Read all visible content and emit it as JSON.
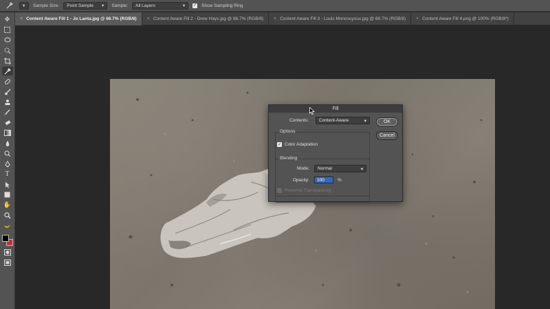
{
  "options_bar": {
    "tool_icon": "eyedropper-icon",
    "sample_size_label": "Sample Size:",
    "sample_size_value": "Point Sample",
    "sample_label": "Sample:",
    "sample_value": "All Layers",
    "show_sampling_ring_label": "Show Sampling Ring"
  },
  "tabs": [
    {
      "label": "Content Aware Fill 1 - Jo Lanta.jpg @ 66.7% (RGB/8)",
      "active": true
    },
    {
      "label": "Content Aware Fill 2 - Drew Hays.jpg @ 66.7% (RGB/8)",
      "active": false
    },
    {
      "label": "Content Aware Fill 3 - Louis Moncouyoux.jpg @ 66.7% (RGB/8)",
      "active": false
    },
    {
      "label": "Content Aware Fill 4.png @ 100% (RGB/8*)",
      "active": false
    }
  ],
  "fill_dialog": {
    "title": "Fill",
    "contents_label": "Contents:",
    "contents_value": "Content-Aware",
    "ok_label": "OK",
    "cancel_label": "Cancel",
    "options_title": "Options",
    "color_adaptation_label": "Color Adaptation",
    "blending_title": "Blending",
    "mode_label": "Mode:",
    "mode_value": "Normal",
    "opacity_label": "Opacity:",
    "opacity_value": "100",
    "opacity_unit": "%",
    "preserve_transparency_label": "Preserve Transparency"
  },
  "colors": {
    "arrow": "#2fd3a0",
    "foreground": "#000000",
    "background": "#d12b2b"
  }
}
